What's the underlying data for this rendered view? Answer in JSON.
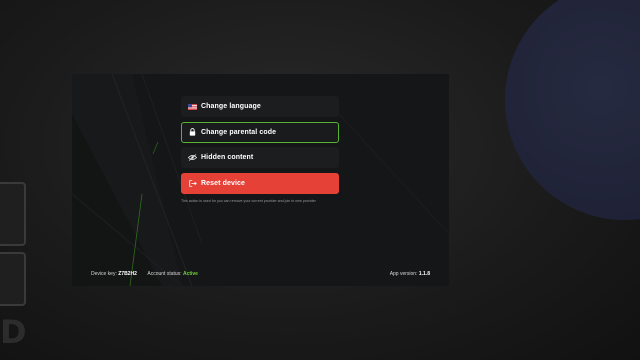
{
  "menu": {
    "items": [
      {
        "label": "Change language",
        "icon": "us-flag-icon"
      },
      {
        "label": "Change parental code",
        "icon": "lock-icon"
      },
      {
        "label": "Hidden content",
        "icon": "eye-off-icon"
      },
      {
        "label": "Reset device",
        "icon": "logout-icon"
      }
    ],
    "focused_index": 1,
    "reset_hint": "This action is used for you can remove your current provider and join to new provider"
  },
  "footer": {
    "device_key_label": "Device key:",
    "device_key_value": "Z7B2H2",
    "account_status_label": "Account status:",
    "account_status_value": "Active",
    "app_version_label": "App version:",
    "app_version_value": "1.1.8"
  },
  "colors": {
    "accent_green": "#58b330",
    "danger_red": "#e64137",
    "status_active": "#6fd03a",
    "panel_bg": "#151617"
  },
  "background": {
    "edge_letter": "D"
  }
}
